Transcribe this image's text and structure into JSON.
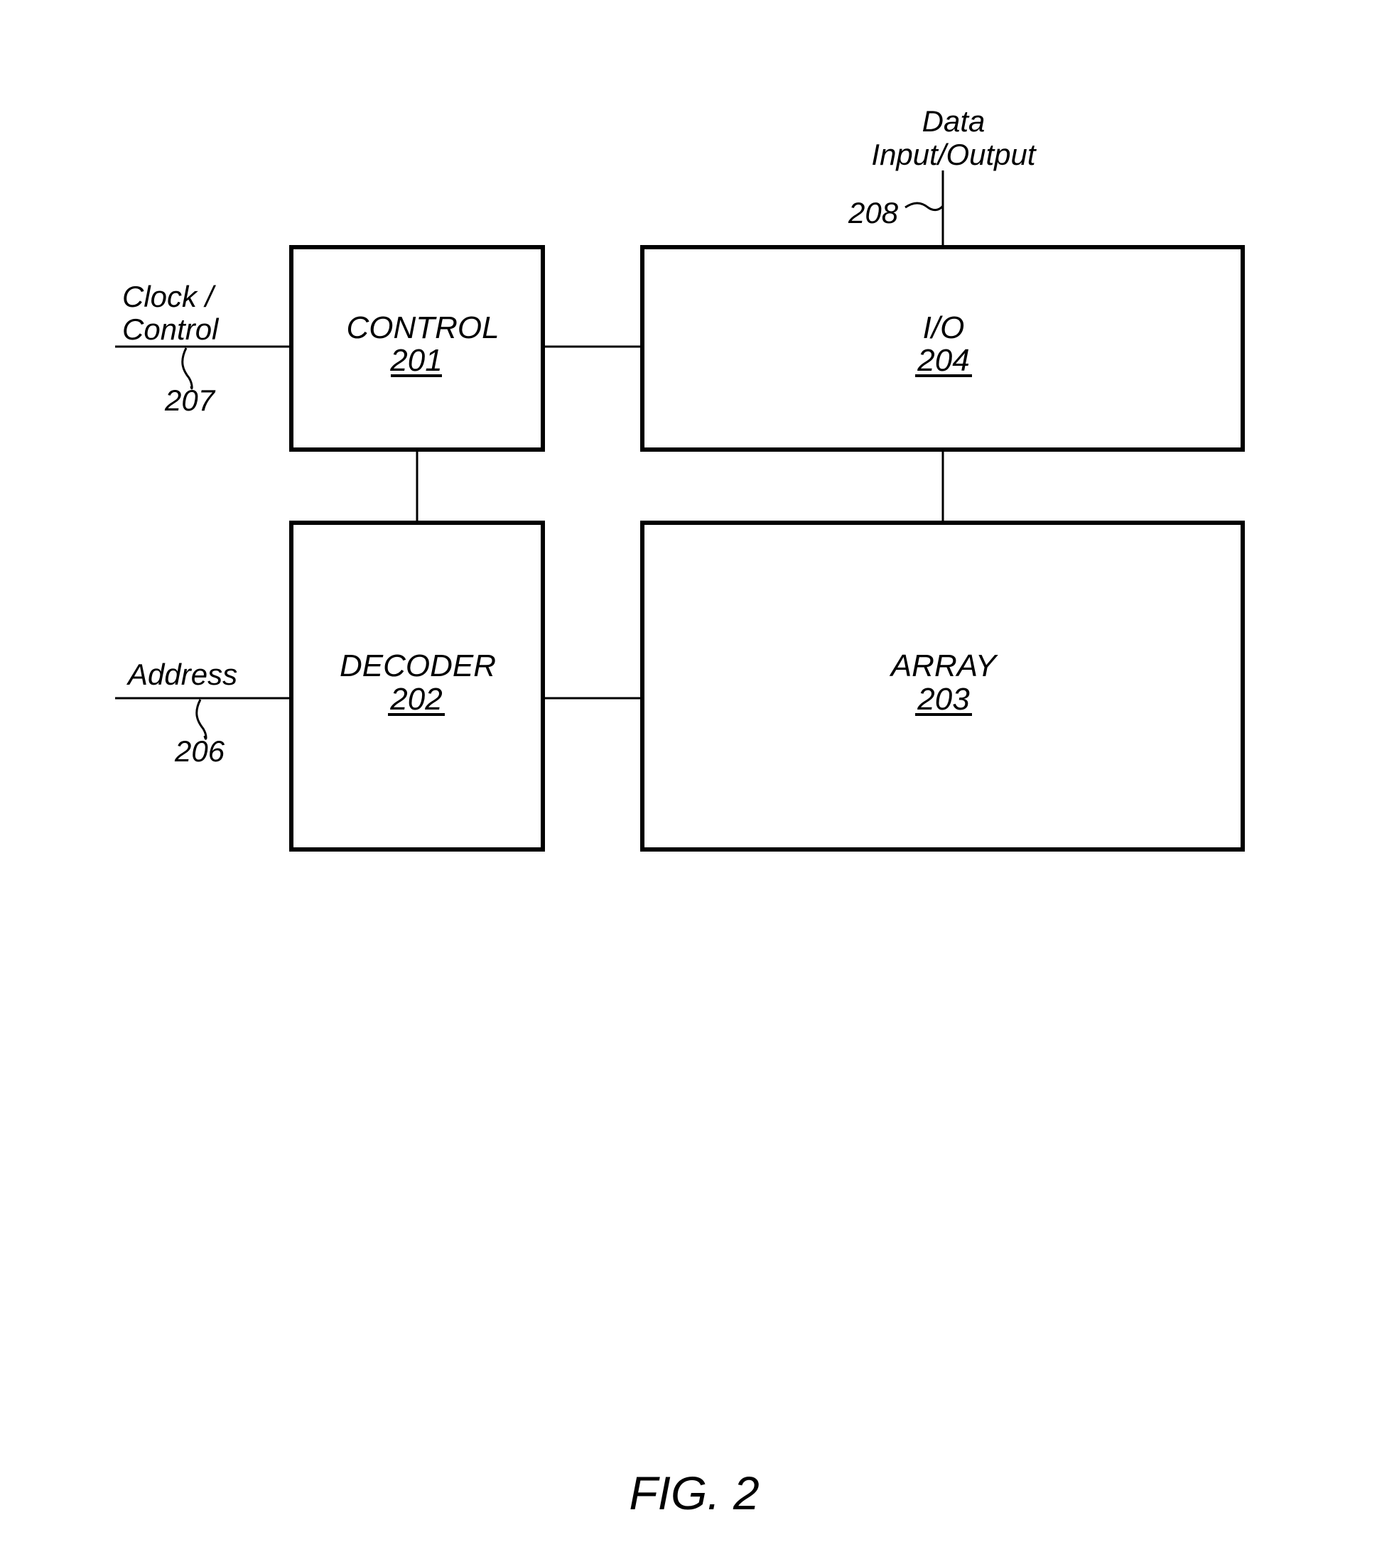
{
  "figure": {
    "caption": "FIG. 2",
    "colors": {
      "line": "#000000",
      "background": "#ffffff"
    }
  },
  "blocks": {
    "control": {
      "name": "CONTROL",
      "ref": "201"
    },
    "decoder": {
      "name": "DECODER",
      "ref": "202"
    },
    "array": {
      "name": "ARRAY",
      "ref": "203"
    },
    "io": {
      "name": "I/O",
      "ref": "204"
    }
  },
  "signals": {
    "address": {
      "lines": [
        "Address"
      ],
      "ref": "206"
    },
    "clock": {
      "lines": [
        "Clock /",
        "Control"
      ],
      "ref": "207"
    },
    "data_io": {
      "lines": [
        "Data",
        "Input/Output"
      ],
      "ref": "208"
    }
  },
  "connections": [
    {
      "from": "clock",
      "to": "control"
    },
    {
      "from": "address",
      "to": "decoder"
    },
    {
      "from": "data_io",
      "to": "io"
    },
    {
      "from": "control",
      "to": "io"
    },
    {
      "from": "control",
      "to": "decoder"
    },
    {
      "from": "io",
      "to": "array"
    },
    {
      "from": "decoder",
      "to": "array"
    }
  ]
}
